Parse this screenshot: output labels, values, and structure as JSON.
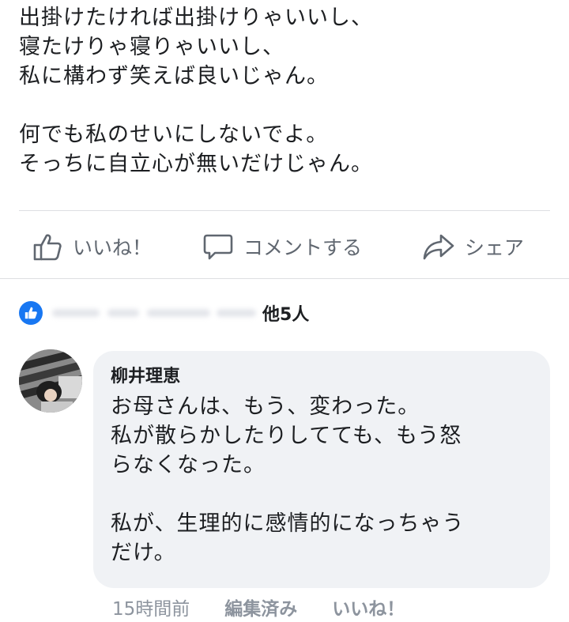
{
  "post": {
    "lines": [
      "出掛けたければ出掛けりゃいいし、",
      "寝たけりゃ寝りゃいいし、",
      "私に構わず笑えば良いじゃん。",
      "",
      "何でも私のせいにしないでよ。",
      "そっちに自立心が無いだけじゃん。"
    ]
  },
  "actions": {
    "like_label": "いいね！",
    "comment_label": "コメントする",
    "share_label": "シェア"
  },
  "reactions": {
    "others_text": "他5人"
  },
  "comment": {
    "author": "柳井理恵",
    "lines": [
      "お母さんは、もう、変わった。",
      "私が散らかしたりしてても、もう怒",
      "らなくなった。",
      "",
      "私が、生理的に感情的になっちゃう",
      "だけ。"
    ],
    "time": "15時間前",
    "edited": "編集済み",
    "like": "いいね！"
  },
  "colors": {
    "accent": "#1877f2",
    "secondary_text": "#606770",
    "meta_text": "#8d949e",
    "bubble_bg": "#f0f2f5"
  },
  "icons": [
    "thumbs-up-icon",
    "comment-icon",
    "share-icon",
    "like-reaction-icon"
  ]
}
